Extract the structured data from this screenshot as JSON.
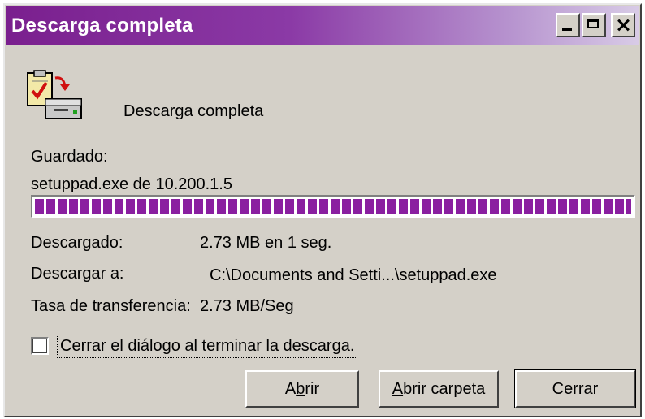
{
  "window": {
    "title": "Descarga completa"
  },
  "icons": {
    "app": "download-complete-icon",
    "minimize": "minimize-icon",
    "maximize": "maximize-icon",
    "close": "close-icon"
  },
  "header": {
    "message": "Descarga completa"
  },
  "details": {
    "saved_label": "Guardado:",
    "saved_value": "setuppad.exe de 10.200.1.5",
    "progress_percent": 100,
    "downloaded_label": "Descargado:",
    "downloaded_value": "2.73 MB en 1 seg.",
    "download_to_label": "Descargar a:",
    "download_to_value": "C:\\Documents and Setti...\\setuppad.exe",
    "rate_label": "Tasa de transferencia:",
    "rate_value": "2.73 MB/Seg"
  },
  "options": {
    "close_on_finish_label": "Cerrar el diálogo al terminar la descarga.",
    "close_on_finish_checked": false
  },
  "buttons": {
    "open_label_pre": "A",
    "open_label_key": "b",
    "open_label_post": "rir",
    "open_folder_label_key": "A",
    "open_folder_label_post": "brir carpeta",
    "close_label": "Cerrar"
  },
  "colors": {
    "title_bar": "#7a1f8e",
    "progress": "#8a1fa0",
    "face": "#d4d0c8"
  }
}
